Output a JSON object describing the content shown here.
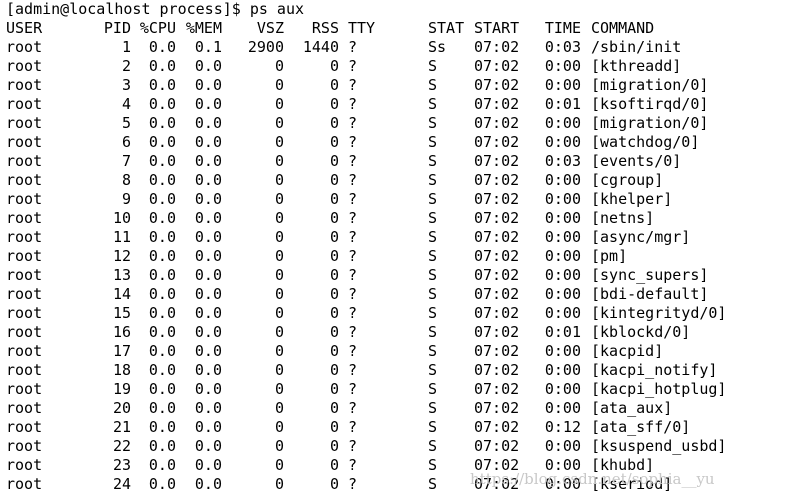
{
  "prompt": {
    "text": "[admin@localhost process]$ ps aux"
  },
  "columns": {
    "user": "USER",
    "pid": "PID",
    "cpu": "%CPU",
    "mem": "%MEM",
    "vsz": "VSZ",
    "rss": "RSS",
    "tty": "TTY",
    "stat": "STAT",
    "start": "START",
    "time": "TIME",
    "command": "COMMAND"
  },
  "rows": [
    {
      "user": "root",
      "pid": "1",
      "cpu": "0.0",
      "mem": "0.1",
      "vsz": "2900",
      "rss": "1440",
      "tty": "?",
      "stat": "Ss",
      "start": "07:02",
      "time": "0:03",
      "command": "/sbin/init"
    },
    {
      "user": "root",
      "pid": "2",
      "cpu": "0.0",
      "mem": "0.0",
      "vsz": "0",
      "rss": "0",
      "tty": "?",
      "stat": "S",
      "start": "07:02",
      "time": "0:00",
      "command": "[kthreadd]"
    },
    {
      "user": "root",
      "pid": "3",
      "cpu": "0.0",
      "mem": "0.0",
      "vsz": "0",
      "rss": "0",
      "tty": "?",
      "stat": "S",
      "start": "07:02",
      "time": "0:00",
      "command": "[migration/0]"
    },
    {
      "user": "root",
      "pid": "4",
      "cpu": "0.0",
      "mem": "0.0",
      "vsz": "0",
      "rss": "0",
      "tty": "?",
      "stat": "S",
      "start": "07:02",
      "time": "0:01",
      "command": "[ksoftirqd/0]"
    },
    {
      "user": "root",
      "pid": "5",
      "cpu": "0.0",
      "mem": "0.0",
      "vsz": "0",
      "rss": "0",
      "tty": "?",
      "stat": "S",
      "start": "07:02",
      "time": "0:00",
      "command": "[migration/0]"
    },
    {
      "user": "root",
      "pid": "6",
      "cpu": "0.0",
      "mem": "0.0",
      "vsz": "0",
      "rss": "0",
      "tty": "?",
      "stat": "S",
      "start": "07:02",
      "time": "0:00",
      "command": "[watchdog/0]"
    },
    {
      "user": "root",
      "pid": "7",
      "cpu": "0.0",
      "mem": "0.0",
      "vsz": "0",
      "rss": "0",
      "tty": "?",
      "stat": "S",
      "start": "07:02",
      "time": "0:03",
      "command": "[events/0]"
    },
    {
      "user": "root",
      "pid": "8",
      "cpu": "0.0",
      "mem": "0.0",
      "vsz": "0",
      "rss": "0",
      "tty": "?",
      "stat": "S",
      "start": "07:02",
      "time": "0:00",
      "command": "[cgroup]"
    },
    {
      "user": "root",
      "pid": "9",
      "cpu": "0.0",
      "mem": "0.0",
      "vsz": "0",
      "rss": "0",
      "tty": "?",
      "stat": "S",
      "start": "07:02",
      "time": "0:00",
      "command": "[khelper]"
    },
    {
      "user": "root",
      "pid": "10",
      "cpu": "0.0",
      "mem": "0.0",
      "vsz": "0",
      "rss": "0",
      "tty": "?",
      "stat": "S",
      "start": "07:02",
      "time": "0:00",
      "command": "[netns]"
    },
    {
      "user": "root",
      "pid": "11",
      "cpu": "0.0",
      "mem": "0.0",
      "vsz": "0",
      "rss": "0",
      "tty": "?",
      "stat": "S",
      "start": "07:02",
      "time": "0:00",
      "command": "[async/mgr]"
    },
    {
      "user": "root",
      "pid": "12",
      "cpu": "0.0",
      "mem": "0.0",
      "vsz": "0",
      "rss": "0",
      "tty": "?",
      "stat": "S",
      "start": "07:02",
      "time": "0:00",
      "command": "[pm]"
    },
    {
      "user": "root",
      "pid": "13",
      "cpu": "0.0",
      "mem": "0.0",
      "vsz": "0",
      "rss": "0",
      "tty": "?",
      "stat": "S",
      "start": "07:02",
      "time": "0:00",
      "command": "[sync_supers]"
    },
    {
      "user": "root",
      "pid": "14",
      "cpu": "0.0",
      "mem": "0.0",
      "vsz": "0",
      "rss": "0",
      "tty": "?",
      "stat": "S",
      "start": "07:02",
      "time": "0:00",
      "command": "[bdi-default]"
    },
    {
      "user": "root",
      "pid": "15",
      "cpu": "0.0",
      "mem": "0.0",
      "vsz": "0",
      "rss": "0",
      "tty": "?",
      "stat": "S",
      "start": "07:02",
      "time": "0:00",
      "command": "[kintegrityd/0]"
    },
    {
      "user": "root",
      "pid": "16",
      "cpu": "0.0",
      "mem": "0.0",
      "vsz": "0",
      "rss": "0",
      "tty": "?",
      "stat": "S",
      "start": "07:02",
      "time": "0:01",
      "command": "[kblockd/0]"
    },
    {
      "user": "root",
      "pid": "17",
      "cpu": "0.0",
      "mem": "0.0",
      "vsz": "0",
      "rss": "0",
      "tty": "?",
      "stat": "S",
      "start": "07:02",
      "time": "0:00",
      "command": "[kacpid]"
    },
    {
      "user": "root",
      "pid": "18",
      "cpu": "0.0",
      "mem": "0.0",
      "vsz": "0",
      "rss": "0",
      "tty": "?",
      "stat": "S",
      "start": "07:02",
      "time": "0:00",
      "command": "[kacpi_notify]"
    },
    {
      "user": "root",
      "pid": "19",
      "cpu": "0.0",
      "mem": "0.0",
      "vsz": "0",
      "rss": "0",
      "tty": "?",
      "stat": "S",
      "start": "07:02",
      "time": "0:00",
      "command": "[kacpi_hotplug]"
    },
    {
      "user": "root",
      "pid": "20",
      "cpu": "0.0",
      "mem": "0.0",
      "vsz": "0",
      "rss": "0",
      "tty": "?",
      "stat": "S",
      "start": "07:02",
      "time": "0:00",
      "command": "[ata_aux]"
    },
    {
      "user": "root",
      "pid": "21",
      "cpu": "0.0",
      "mem": "0.0",
      "vsz": "0",
      "rss": "0",
      "tty": "?",
      "stat": "S",
      "start": "07:02",
      "time": "0:12",
      "command": "[ata_sff/0]"
    },
    {
      "user": "root",
      "pid": "22",
      "cpu": "0.0",
      "mem": "0.0",
      "vsz": "0",
      "rss": "0",
      "tty": "?",
      "stat": "S",
      "start": "07:02",
      "time": "0:00",
      "command": "[ksuspend_usbd]"
    },
    {
      "user": "root",
      "pid": "23",
      "cpu": "0.0",
      "mem": "0.0",
      "vsz": "0",
      "rss": "0",
      "tty": "?",
      "stat": "S",
      "start": "07:02",
      "time": "0:00",
      "command": "[khubd]"
    },
    {
      "user": "root",
      "pid": "24",
      "cpu": "0.0",
      "mem": "0.0",
      "vsz": "0",
      "rss": "0",
      "tty": "?",
      "stat": "S",
      "start": "07:02",
      "time": "0:00",
      "command": "[kseriod]"
    }
  ],
  "watermark": "https://blog.csdn.net/sophia__yu",
  "colors": {
    "background": "#ffffff",
    "foreground": "#000000",
    "watermark": "#c8c8c8"
  }
}
